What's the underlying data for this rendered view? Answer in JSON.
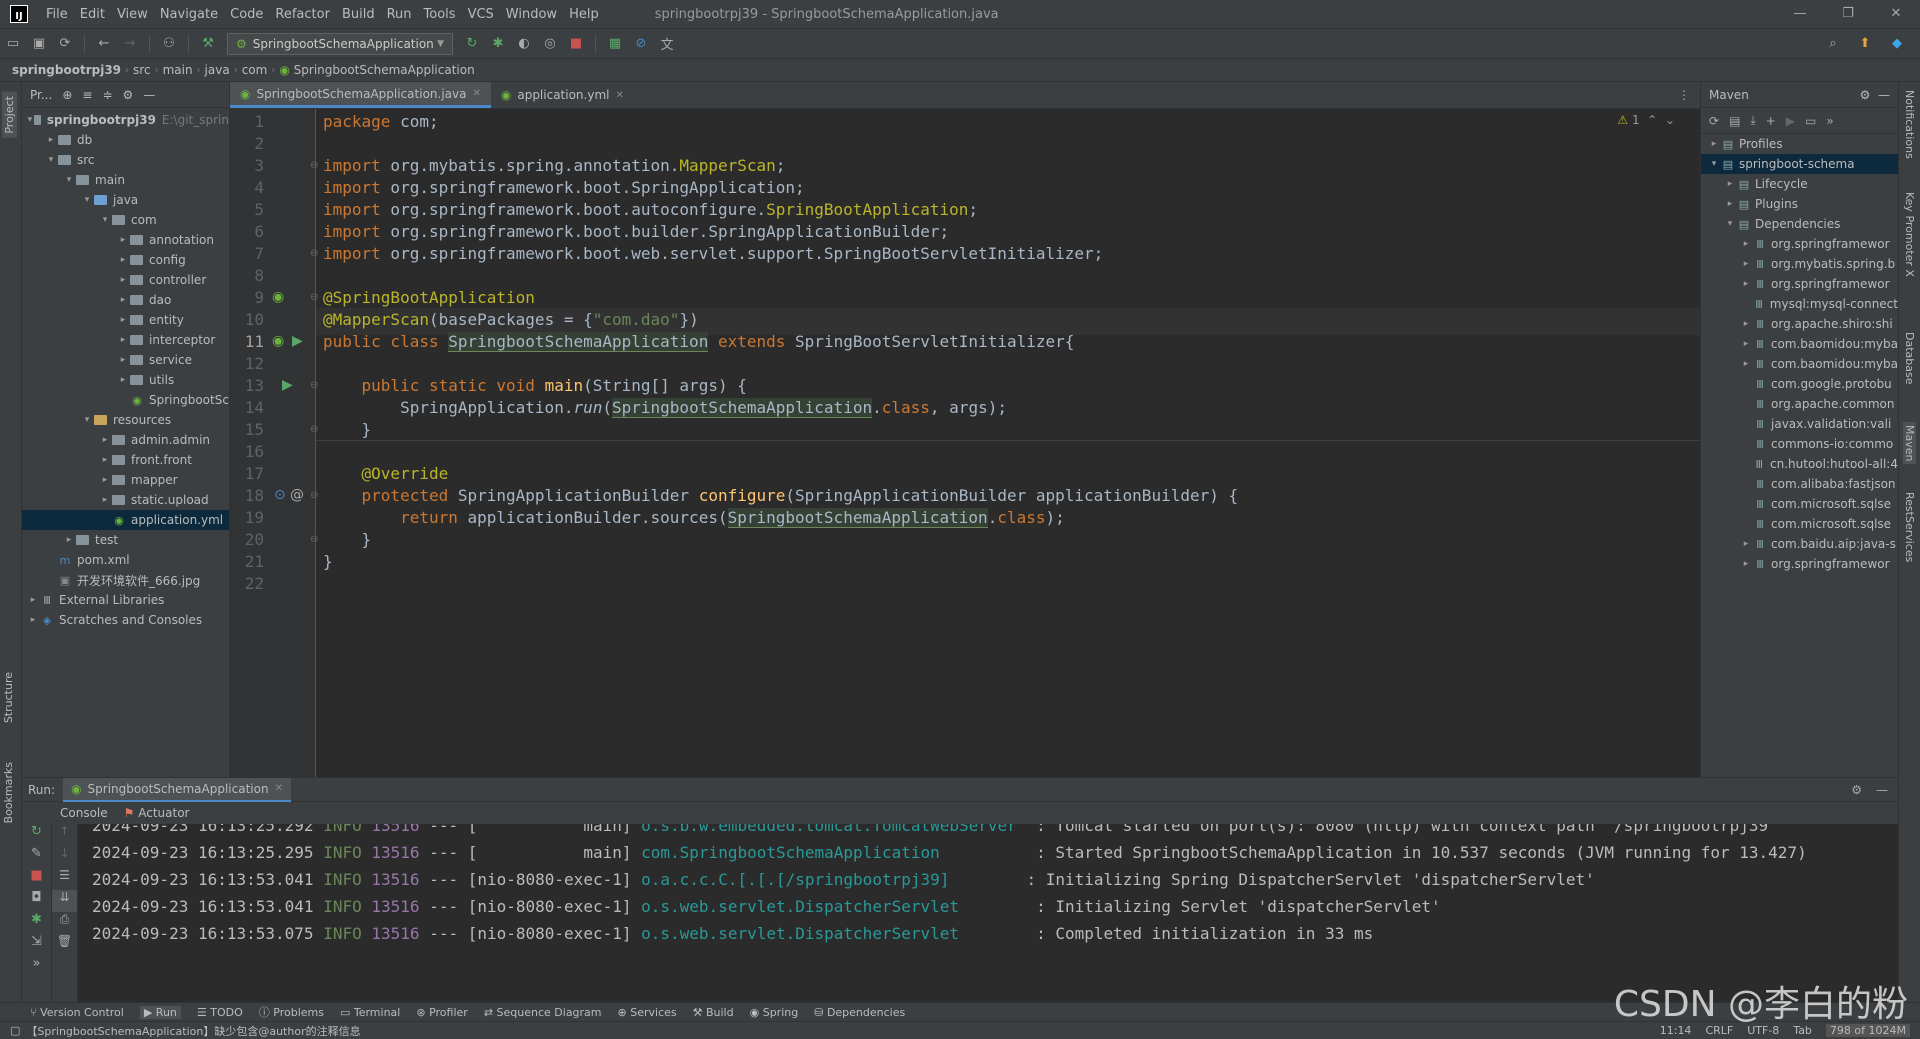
{
  "window": {
    "title": "springbootrpj39 - SpringbootSchemaApplication.java"
  },
  "menu": [
    "File",
    "Edit",
    "View",
    "Navigate",
    "Code",
    "Refactor",
    "Build",
    "Run",
    "Tools",
    "VCS",
    "Window",
    "Help"
  ],
  "toolbar": {
    "run_config": "SpringbootSchemaApplication"
  },
  "breadcrumb": [
    "springbootrpj39",
    "src",
    "main",
    "java",
    "com",
    "SpringbootSchemaApplication"
  ],
  "project": {
    "title": "Pr...",
    "tree": [
      {
        "label": "springbootrpj39",
        "extra": "E:\\git_sprin",
        "indent": 0,
        "arrow": "▾",
        "type": "folder"
      },
      {
        "label": "db",
        "indent": 1,
        "arrow": "▸",
        "type": "folder"
      },
      {
        "label": "src",
        "indent": 1,
        "arrow": "▾",
        "type": "folder"
      },
      {
        "label": "main",
        "indent": 2,
        "arrow": "▾",
        "type": "folder"
      },
      {
        "label": "java",
        "indent": 3,
        "arrow": "▾",
        "type": "blue"
      },
      {
        "label": "com",
        "indent": 4,
        "arrow": "▾",
        "type": "folder"
      },
      {
        "label": "annotation",
        "indent": 5,
        "arrow": "▸",
        "type": "folder"
      },
      {
        "label": "config",
        "indent": 5,
        "arrow": "▸",
        "type": "folder"
      },
      {
        "label": "controller",
        "indent": 5,
        "arrow": "▸",
        "type": "folder"
      },
      {
        "label": "dao",
        "indent": 5,
        "arrow": "▸",
        "type": "folder"
      },
      {
        "label": "entity",
        "indent": 5,
        "arrow": "▸",
        "type": "folder"
      },
      {
        "label": "interceptor",
        "indent": 5,
        "arrow": "▸",
        "type": "folder"
      },
      {
        "label": "service",
        "indent": 5,
        "arrow": "▸",
        "type": "folder"
      },
      {
        "label": "utils",
        "indent": 5,
        "arrow": "▸",
        "type": "folder"
      },
      {
        "label": "SpringbootSc",
        "indent": 5,
        "arrow": "",
        "type": "spring"
      },
      {
        "label": "resources",
        "indent": 3,
        "arrow": "▾",
        "type": "ylw"
      },
      {
        "label": "admin.admin",
        "indent": 4,
        "arrow": "▸",
        "type": "folder"
      },
      {
        "label": "front.front",
        "indent": 4,
        "arrow": "▸",
        "type": "folder"
      },
      {
        "label": "mapper",
        "indent": 4,
        "arrow": "▸",
        "type": "folder"
      },
      {
        "label": "static.upload",
        "indent": 4,
        "arrow": "▸",
        "type": "folder"
      },
      {
        "label": "application.yml",
        "indent": 4,
        "arrow": "",
        "type": "yml",
        "selected": true
      },
      {
        "label": "test",
        "indent": 2,
        "arrow": "▸",
        "type": "folder"
      },
      {
        "label": "pom.xml",
        "indent": 1,
        "arrow": "",
        "type": "maven"
      },
      {
        "label": "开发环境软件_666.jpg",
        "indent": 1,
        "arrow": "",
        "type": "img"
      },
      {
        "label": "External Libraries",
        "indent": 0,
        "arrow": "▸",
        "type": "lib"
      },
      {
        "label": "Scratches and Consoles",
        "indent": 0,
        "arrow": "▸",
        "type": "scratch"
      }
    ]
  },
  "tabs": [
    {
      "label": "SpringbootSchemaApplication.java",
      "active": true
    },
    {
      "label": "application.yml",
      "active": false
    }
  ],
  "editor": {
    "warning_count": "1",
    "line_numbers": [
      "1",
      "2",
      "3",
      "4",
      "5",
      "6",
      "7",
      "8",
      "9",
      "10",
      "11",
      "12",
      "13",
      "14",
      "15",
      "16",
      "17",
      "18",
      "19",
      "20",
      "21",
      "22"
    ]
  },
  "maven": {
    "title": "Maven",
    "tree": [
      {
        "label": "Profiles",
        "indent": 0,
        "arrow": "▸"
      },
      {
        "label": "springboot-schema",
        "indent": 0,
        "arrow": "▾",
        "selected": true
      },
      {
        "label": "Lifecycle",
        "indent": 1,
        "arrow": "▸"
      },
      {
        "label": "Plugins",
        "indent": 1,
        "arrow": "▸"
      },
      {
        "label": "Dependencies",
        "indent": 1,
        "arrow": "▾"
      },
      {
        "label": "org.springframewor",
        "indent": 2,
        "arrow": "▸"
      },
      {
        "label": "org.mybatis.spring.b",
        "indent": 2,
        "arrow": "▸"
      },
      {
        "label": "org.springframewor",
        "indent": 2,
        "arrow": "▸"
      },
      {
        "label": "mysql:mysql-connect",
        "indent": 2,
        "arrow": ""
      },
      {
        "label": "org.apache.shiro:shi",
        "indent": 2,
        "arrow": "▸"
      },
      {
        "label": "com.baomidou:myba",
        "indent": 2,
        "arrow": "▸"
      },
      {
        "label": "com.baomidou:myba",
        "indent": 2,
        "arrow": "▸"
      },
      {
        "label": "com.google.protobu",
        "indent": 2,
        "arrow": ""
      },
      {
        "label": "org.apache.common",
        "indent": 2,
        "arrow": ""
      },
      {
        "label": "javax.validation:vali",
        "indent": 2,
        "arrow": ""
      },
      {
        "label": "commons-io:commo",
        "indent": 2,
        "arrow": ""
      },
      {
        "label": "cn.hutool:hutool-all:4",
        "indent": 2,
        "arrow": ""
      },
      {
        "label": "com.alibaba:fastjson",
        "indent": 2,
        "arrow": ""
      },
      {
        "label": "com.microsoft.sqlse",
        "indent": 2,
        "arrow": ""
      },
      {
        "label": "com.microsoft.sqlse",
        "indent": 2,
        "arrow": ""
      },
      {
        "label": "com.baidu.aip:java-s",
        "indent": 2,
        "arrow": "▸"
      },
      {
        "label": "org.springframewor",
        "indent": 2,
        "arrow": "▸"
      }
    ]
  },
  "run": {
    "label": "Run:",
    "tab": "SpringbootSchemaApplication",
    "subtabs": [
      "Console",
      "Actuator"
    ],
    "logs": [
      {
        "ts": "2024-09-23 16:13:25.292",
        "lvl": "INFO",
        "pid": "13516",
        "thread": "--- [           main]",
        "cls": "o.s.b.w.embedded.tomcat.TomcatWebServer ",
        "msg": ": Tomcat started on port(s): 8080 (http) with context path '/springbootrpj39"
      },
      {
        "ts": "2024-09-23 16:13:25.295",
        "lvl": "INFO",
        "pid": "13516",
        "thread": "--- [           main]",
        "cls": "com.SpringbootSchemaApplication         ",
        "msg": ": Started SpringbootSchemaApplication in 10.537 seconds (JVM running for 13.427)"
      },
      {
        "ts": "2024-09-23 16:13:53.041",
        "lvl": "INFO",
        "pid": "13516",
        "thread": "--- [nio-8080-exec-1]",
        "cls": "o.a.c.c.C.[.[.[/springbootrpj39]       ",
        "msg": ": Initializing Spring DispatcherServlet 'dispatcherServlet'"
      },
      {
        "ts": "2024-09-23 16:13:53.041",
        "lvl": "INFO",
        "pid": "13516",
        "thread": "--- [nio-8080-exec-1]",
        "cls": "o.s.web.servlet.DispatcherServlet       ",
        "msg": ": Initializing Servlet 'dispatcherServlet'"
      },
      {
        "ts": "2024-09-23 16:13:53.075",
        "lvl": "INFO",
        "pid": "13516",
        "thread": "--- [nio-8080-exec-1]",
        "cls": "o.s.web.servlet.DispatcherServlet       ",
        "msg": ": Completed initialization in 33 ms"
      }
    ]
  },
  "bottom_tabs": [
    "Version Control",
    "Run",
    "TODO",
    "Problems",
    "Terminal",
    "Profiler",
    "Sequence Diagram",
    "Services",
    "Build",
    "Spring",
    "Dependencies"
  ],
  "side_tabs": {
    "left": [
      "Project",
      "Structure",
      "Bookmarks"
    ],
    "right": [
      "Notifications",
      "Key Promoter X",
      "Database",
      "Maven",
      "RestServices"
    ]
  },
  "status": {
    "message": "【SpringbootSchemaApplication】缺少包含@author的注释信息",
    "position": "11:14",
    "line_sep": "CRLF",
    "encoding": "UTF-8",
    "indent": "Tab",
    "memory": "798 of 1024M"
  },
  "watermark": "CSDN @李白的粉"
}
